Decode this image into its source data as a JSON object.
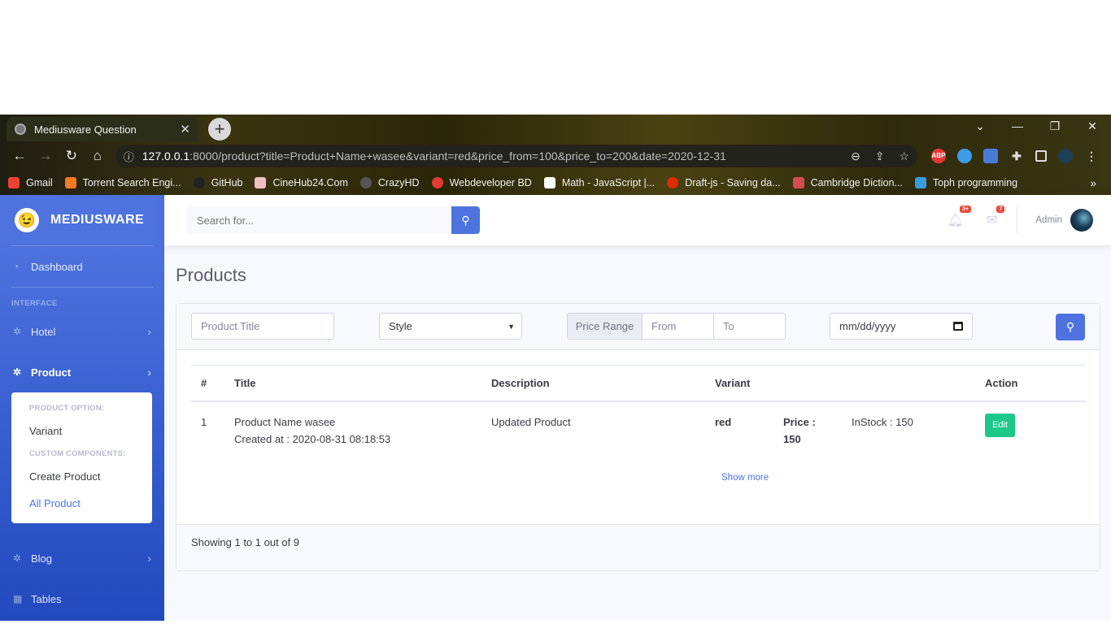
{
  "browser": {
    "tab_title": "Mediusware Question",
    "tab_close": "✕",
    "new_tab": "+",
    "window_controls": [
      "⌄",
      "—",
      "❐",
      "✕"
    ],
    "url_host": "127.0.0.1",
    "url_rest": ":8000/product?title=Product+Name+wasee&variant=red&price_from=100&price_to=200&date=2020-12-31",
    "bookmarks": [
      {
        "label": "Gmail",
        "color": "#ea4335"
      },
      {
        "label": "Torrent Search Engi...",
        "color": "#f47b20"
      },
      {
        "label": "GitHub",
        "color": "#222222"
      },
      {
        "label": "CineHub24.Com",
        "color": "#f0c0c0"
      },
      {
        "label": "CrazyHD",
        "color": "#555555"
      },
      {
        "label": "Webdeveloper BD",
        "color": "#e53935"
      },
      {
        "label": "Math - JavaScript |...",
        "color": "#ffffff"
      },
      {
        "label": "Draft-js - Saving da...",
        "color": "#dd2c00"
      },
      {
        "label": "Cambridge Diction...",
        "color": "#d24d4d"
      },
      {
        "label": "Toph programming",
        "color": "#3a9bdc"
      }
    ],
    "bookmarks_more": "»",
    "ext_abp": "ABP"
  },
  "sidebar": {
    "brand": "MEDIUSWARE",
    "brand_logo": "😉",
    "dashboard": "Dashboard",
    "heading_interface": "INTERFACE",
    "hotel": "Hotel",
    "product": "Product",
    "submenu": {
      "heading_option": "PRODUCT OPTION:",
      "variant": "Variant",
      "heading_custom": "CUSTOM COMPONENTS:",
      "create": "Create Product",
      "all": "All Product"
    },
    "blog": "Blog",
    "tables": "Tables"
  },
  "topbar": {
    "search_placeholder": "Search for...",
    "alerts_badge": "3+",
    "messages_badge": "7",
    "user_name": "Admin"
  },
  "page": {
    "title": "Products"
  },
  "filters": {
    "title_placeholder": "Product Title",
    "style_value": "Style",
    "price_range_label": "Price Range",
    "from_placeholder": "From",
    "to_placeholder": "To",
    "date_placeholder": "mm/dd/yyyy"
  },
  "table": {
    "headers": [
      "#",
      "Title",
      "Description",
      "Variant",
      "Action"
    ],
    "rows": [
      {
        "index": "1",
        "title": "Product Name wasee",
        "created": "Created at : 2020-08-31 08:18:53",
        "description": "Updated Product",
        "variant_name": "red",
        "price_label": "Price :",
        "price_value": "150",
        "stock": "InStock : 150",
        "action": "Edit"
      }
    ],
    "show_more": "Show more"
  },
  "footer": {
    "showing": "Showing 1 to 1 out of 9"
  }
}
